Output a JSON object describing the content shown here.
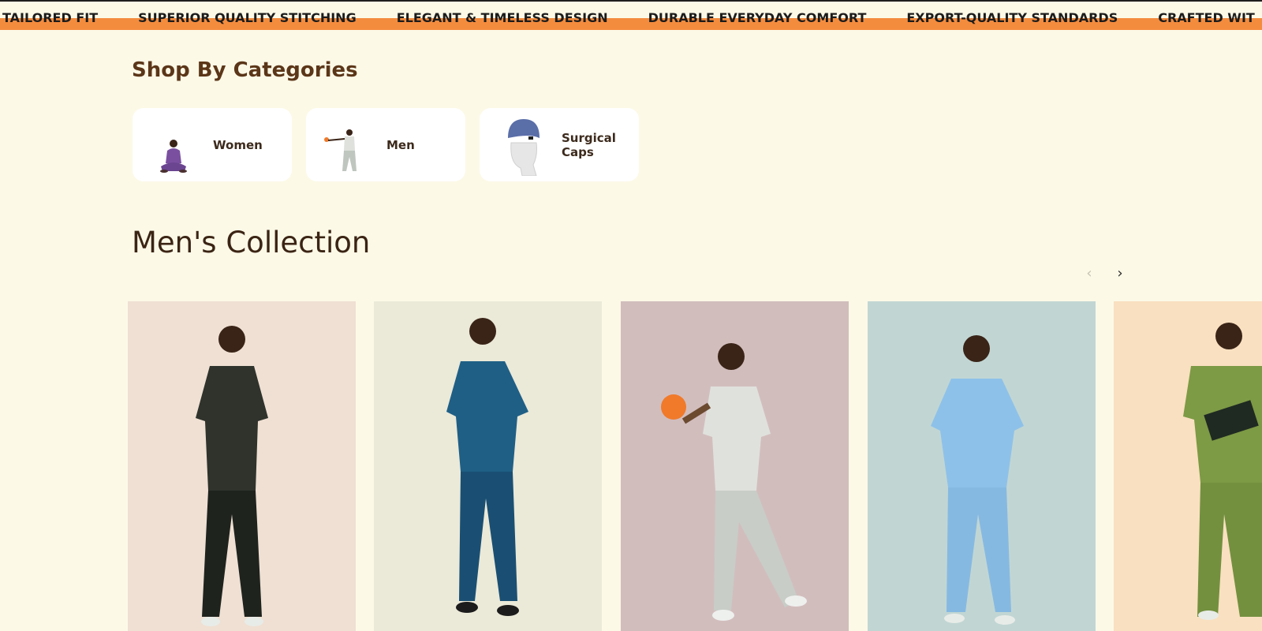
{
  "marquee": {
    "items": [
      "TAILORED FIT",
      "SUPERIOR QUALITY STITCHING",
      "ELEGANT & TIMELESS DESIGN",
      "DURABLE EVERYDAY COMFORT",
      "EXPORT-QUALITY STANDARDS",
      "CRAFTED WIT"
    ],
    "accent_color": "#f48c3e"
  },
  "categories": {
    "title": "Shop By Categories",
    "items": [
      {
        "label": "Women",
        "icon": "women-category-image"
      },
      {
        "label": "Men",
        "icon": "men-category-image"
      },
      {
        "label": "Surgical Caps",
        "icon": "surgical-cap-image"
      }
    ]
  },
  "collection": {
    "title": "Men's Collection",
    "prev_icon": "chevron-left-icon",
    "next_icon": "chevron-right-icon",
    "products": [
      {
        "bg": "#efe0d3",
        "scrub_color": "#2f332c",
        "pants_color": "#1f231e"
      },
      {
        "bg": "#ebe9d8",
        "scrub_color": "#1f5f86",
        "pants_color": "#1a4f73"
      },
      {
        "bg": "#d2bdbd",
        "scrub_color": "#dfe1dc",
        "pants_color": "#c8cdc7"
      },
      {
        "bg": "#c1d6d3",
        "scrub_color": "#8ec1e9",
        "pants_color": "#86b9e2"
      },
      {
        "bg": "#f9e0c0",
        "scrub_color": "#7d9a45",
        "pants_color": "#73903f"
      }
    ]
  },
  "colors": {
    "page_bg": "#fcf9e7",
    "heading_brown": "#5b3618"
  }
}
